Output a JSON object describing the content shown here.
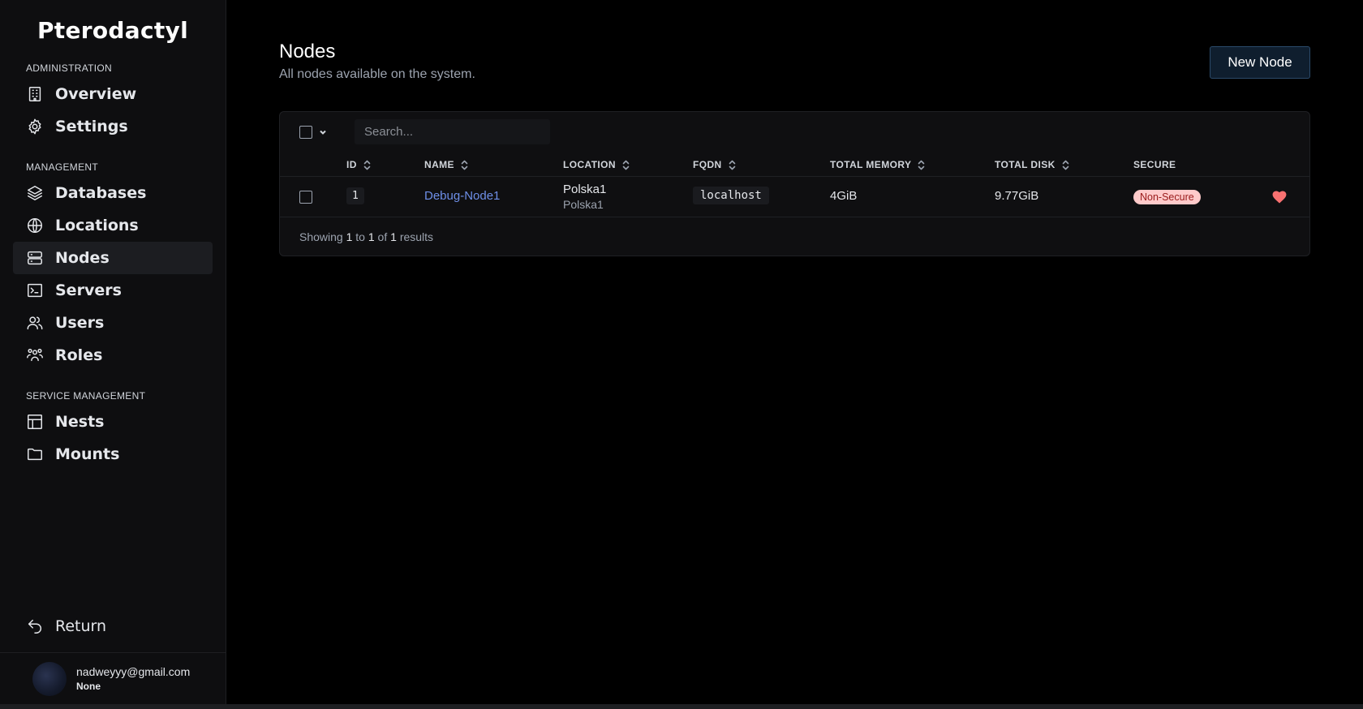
{
  "brand": "Pterodactyl",
  "sidebar": {
    "sections": [
      {
        "label": "ADMINISTRATION",
        "items": [
          {
            "label": "Overview",
            "icon": "building-icon",
            "active": false
          },
          {
            "label": "Settings",
            "icon": "gear-icon",
            "active": false
          }
        ]
      },
      {
        "label": "MANAGEMENT",
        "items": [
          {
            "label": "Databases",
            "icon": "layers-icon",
            "active": false
          },
          {
            "label": "Locations",
            "icon": "globe-icon",
            "active": false
          },
          {
            "label": "Nodes",
            "icon": "server-icon",
            "active": true
          },
          {
            "label": "Servers",
            "icon": "terminal-icon",
            "active": false
          },
          {
            "label": "Users",
            "icon": "users-icon",
            "active": false
          },
          {
            "label": "Roles",
            "icon": "user-group-icon",
            "active": false
          }
        ]
      },
      {
        "label": "SERVICE MANAGEMENT",
        "items": [
          {
            "label": "Nests",
            "icon": "table-icon",
            "active": false
          },
          {
            "label": "Mounts",
            "icon": "folder-icon",
            "active": false
          }
        ]
      }
    ],
    "return_label": "Return",
    "user": {
      "email": "nadweyyy@gmail.com",
      "role": "None"
    }
  },
  "page": {
    "title": "Nodes",
    "subtitle": "All nodes available on the system.",
    "new_button": "New Node"
  },
  "table": {
    "search_placeholder": "Search...",
    "columns": [
      "ID",
      "NAME",
      "LOCATION",
      "FQDN",
      "TOTAL MEMORY",
      "TOTAL DISK",
      "SECURE"
    ],
    "rows": [
      {
        "id": "1",
        "name": "Debug-Node1",
        "location": "Polska1",
        "location_sub": "Polska1",
        "fqdn": "localhost",
        "memory": "4GiB",
        "disk": "9.77GiB",
        "secure": "Non-Secure"
      }
    ],
    "footer": {
      "prefix": "Showing",
      "from": "1",
      "to_word": "to",
      "to": "1",
      "of_word": "of",
      "total": "1",
      "suffix": "results"
    }
  },
  "colors": {
    "accent_link": "#6e8fe8",
    "badge_bg": "#fecaca",
    "badge_text": "#991b1b",
    "heart": "#f87171"
  }
}
